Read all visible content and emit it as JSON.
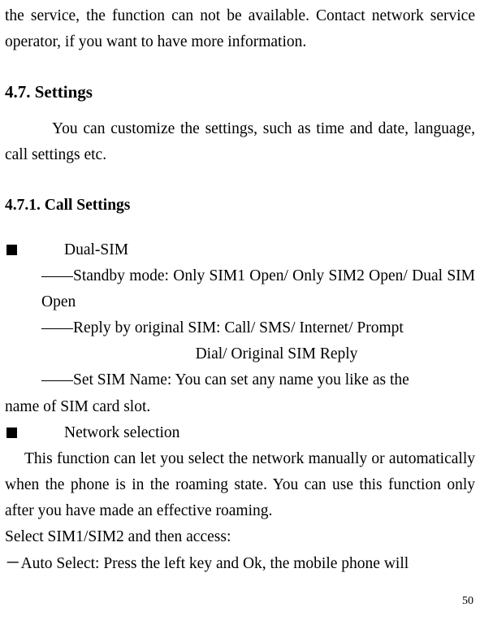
{
  "intro": {
    "p1": "the service, the function can not be available. Contact network service operator, if you want to have more information."
  },
  "section47": {
    "heading": "4.7.   Settings",
    "body": "You can customize the settings, such as time and date, language, call settings etc."
  },
  "section471": {
    "heading": "4.7.1.    Call Settings",
    "dualSim": {
      "label": "Dual-SIM",
      "standby": "――Standby mode: Only SIM1 Open/ Only SIM2 Open/ Dual SIM Open",
      "replyLine1": "――Reply by original SIM: Call/ SMS/ Internet/ Prompt",
      "replyLine2": "Dial/ Original SIM Reply",
      "setName": "――Set SIM Name: You can set any name you like as the",
      "setNameCont": "name of SIM card slot."
    },
    "networkSelection": {
      "label": "Network selection",
      "body": "This function can let you select the network manually or automatically when the phone is in the roaming state. You can use this function only after you have made an effective roaming.",
      "selectLine": "Select SIM1/SIM2 and then access:",
      "autoSelect": "－Auto Select: Press the left key and Ok, the mobile phone will"
    }
  },
  "pageNumber": "50"
}
